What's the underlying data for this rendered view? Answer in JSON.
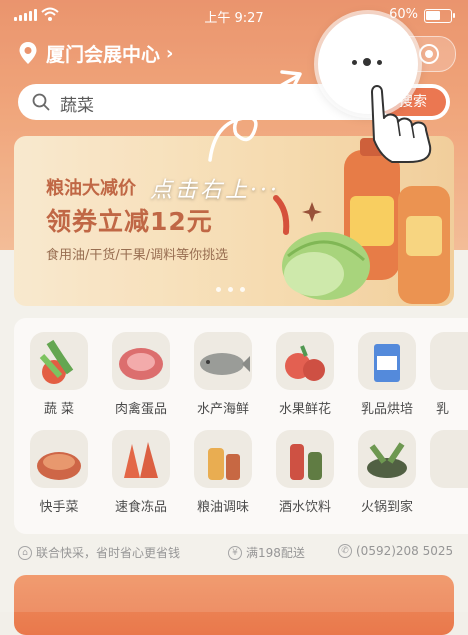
{
  "status_bar": {
    "time": "上午 9:27",
    "battery": "60%",
    "battery_level": 0.6
  },
  "header": {
    "location": "厦门会展中心",
    "location_chevron": "›"
  },
  "search": {
    "query": "蔬菜",
    "button": "搜索"
  },
  "banner": {
    "line1": "粮油大减价",
    "line2": "领券立减12元",
    "line3": "食用油/干货/干果/调料等你挑选",
    "page_count": 3
  },
  "categories": [
    {
      "label": "蔬 菜",
      "icon": "vegetable-icon"
    },
    {
      "label": "肉禽蛋品",
      "icon": "meat-icon"
    },
    {
      "label": "水产海鲜",
      "icon": "fish-icon"
    },
    {
      "label": "水果鲜花",
      "icon": "fruit-icon"
    },
    {
      "label": "乳品烘培",
      "icon": "milk-icon"
    },
    {
      "label": "乳",
      "icon": "dairy-icon"
    },
    {
      "label": "快手菜",
      "icon": "quick-dish-icon"
    },
    {
      "label": "速食冻品",
      "icon": "frozen-food-icon"
    },
    {
      "label": "粮油调味",
      "icon": "grain-oil-icon"
    },
    {
      "label": "酒水饮料",
      "icon": "drinks-icon"
    },
    {
      "label": "火锅到家",
      "icon": "hotpot-icon"
    },
    {
      "label": "",
      "icon": "more-icon"
    }
  ],
  "promo": {
    "item1": "联合快采，省时省心更省钱",
    "item2": "满198配送",
    "item3": "(0592)208 5025"
  },
  "guide": {
    "hint": "点击右上···"
  },
  "colors": {
    "accent": "#e9653a",
    "header": "#e8865a",
    "banner_text": "#b8532c"
  }
}
